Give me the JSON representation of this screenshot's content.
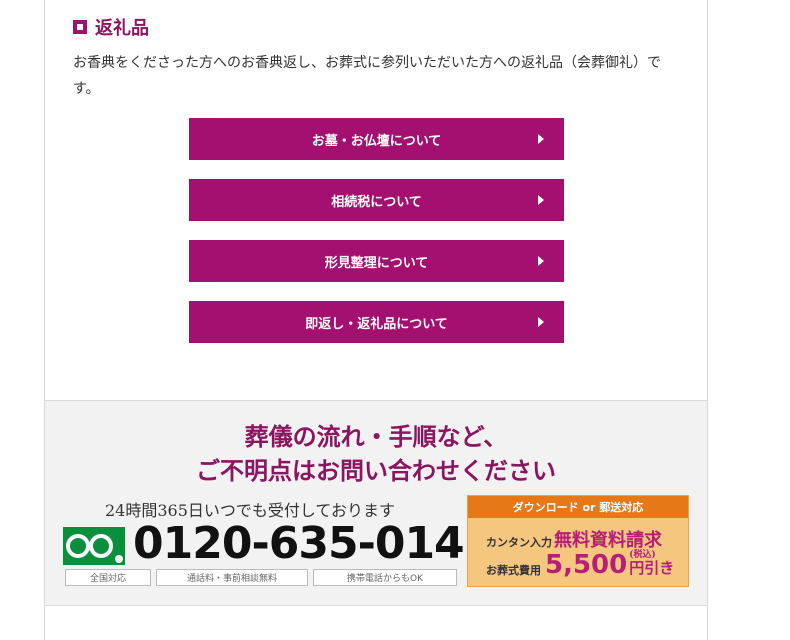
{
  "section": {
    "title": "返礼品"
  },
  "description": "お香典をくださった方へのお香典返し、お葬式に参列いただいた方への返礼品（会葬御礼）です。",
  "links": [
    {
      "label": "お墓・お仏壇について"
    },
    {
      "label": "相続税について"
    },
    {
      "label": "形見整理について"
    },
    {
      "label": "即返し・返礼品について"
    }
  ],
  "contact": {
    "headline_1": "葬儀の流れ・手順など、",
    "headline_2": "ご不明点はお問い合わせください",
    "hours": "24時間365日いつでも受付しております",
    "phone": "0120-635-014",
    "notes": [
      "全国対応",
      "通話料・事前相談無料",
      "携帯電話からもOK"
    ],
    "banner": {
      "top": "ダウンロード or 郵送対応",
      "prefix": "カンタン入力",
      "main": "無料資料請求",
      "cost_label": "お葬式費用",
      "price": "5,500",
      "tax": "(税込)",
      "suffix": "円引き"
    }
  },
  "colors": {
    "accent": "#a4106f",
    "headline": "#8c1561",
    "banner_orange": "#e67817",
    "banner_bg": "#f5c77e"
  }
}
